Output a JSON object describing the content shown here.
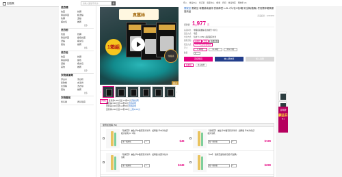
{
  "header": {
    "brand_label": "回首頁",
    "search_placeholder": "請輸入關鍵字查詢",
    "search_button": "搜",
    "nav": [
      "登入",
      "會員中心",
      "會員中心",
      "查訂單",
      "購物車",
      "客服中心",
      "優惠",
      "折扣",
      "會員專區",
      "購物車 (0)"
    ]
  },
  "sidebar": {
    "sections": [
      {
        "title": "洗衣精",
        "items": [
          "抗菌",
          "抗蹣",
          "除臭抑菌",
          "超濃縮",
          "防蹣",
          "濃縮",
          "補充包",
          "推薦"
        ],
        "more": "更多"
      },
      {
        "title": "洗衣粉",
        "items": [
          "抗菌",
          "抗蹣",
          "除臭抑菌",
          "護色抗菌",
          "濃縮",
          "補充包",
          "其他",
          "推薦"
        ],
        "more": "更多"
      },
      {
        "title": "洗衣皂",
        "items": [
          "抗菌",
          "抗蹣",
          "除臭抑菌",
          "護色",
          "濃縮",
          "補充包",
          "其他",
          "推薦"
        ],
        "more": "更多"
      },
      {
        "title": "衣物清潔劑",
        "items": [
          "漂白水",
          "漂白粉",
          "柔軟精",
          "去漬劑",
          "衣領精",
          "洗衣球",
          "其他",
          "推薦"
        ],
        "more": "更多"
      },
      {
        "title": "衣物香氛",
        "items": [
          "香氛袋",
          "香氛噴霧"
        ]
      }
    ]
  },
  "product": {
    "title_brand": "蕾妮亞",
    "title": "蕾妮亞 零觸感真蠶絲 夜用褲型 L-XL 7片/包 8包/箱 衛生棉(箱購)-會員獨享箱購優惠商品",
    "code": "商品編號：12659865",
    "gallery_title": "真蠶絲",
    "gallery_badge": "1箱組",
    "gallery_seal": "零觸感",
    "gallery_caption": "官方",
    "price_label": "促銷價",
    "price": "1,977",
    "price_unit": "元",
    "specs": [
      {
        "k": "商品特色",
        "v": "零觸感真蠶絲 夜用褲型 7片/包"
      },
      {
        "k": "運送方式",
        "v": "宅配"
      },
      {
        "k": "付款方式",
        "v": "信用卡 / ATM / 超商取貨付款"
      }
    ],
    "chips_label": "優惠活動",
    "chips": [
      "滿額折",
      "全館",
      "點數回饋"
    ],
    "shipping_label": "配送方式",
    "shipping_value": "momo宅配/超商取貨",
    "size_label": "尺寸",
    "sizes": [
      "L 102片",
      "XL 96片",
      "XXL 72片"
    ],
    "qty_label": "數量",
    "qty": "1",
    "buttons": {
      "buy": "直接購買",
      "cart": "放入購物車",
      "fav": "加入追蹤"
    },
    "share": [
      "點數換",
      "更多推薦"
    ]
  },
  "promo": {
    "tag": "滿額送",
    "lines": [
      {
        "text": "單筆滿1,000元送 mo幣10元",
        "link": "活動說明"
      },
      {
        "text": "單筆滿2,000元送 mo幣30元",
        "link": "活動說明"
      },
      {
        "text": "單筆滿3,000元送 mo幣50元",
        "link": "活動說明"
      },
      {
        "text": "單筆滿5,000元送 mo幣100元 ",
        "link": "上限3,000元"
      }
    ]
  },
  "bundle": {
    "header": "優惠加價購 (50)",
    "items": [
      {
        "name": "【蕾妮亞】 麗生草中醫豆漿清淨清 · 加購價 草本淨化舒緩沐浴乳(9 / 6件)",
        "option": "選一個規格",
        "qty": "1",
        "price": "$49"
      },
      {
        "name": "【蕾妮亞】 麗生草中醫豆漿清淨清 · 加購價 草本淨化舒緩沐浴乳",
        "option": "選一個規格",
        "qty": "1",
        "price": "$129"
      },
      {
        "name": "【蕾妮亞】 麗生草中醫豆漿清淨清 · 加購價 抗菌淨化沐浴乳",
        "option": "選一個規格",
        "qty": "1",
        "price": "$249"
      },
      {
        "name": "【HE】 蕾妮亞護墊旅行組(可加購)",
        "option": "選一個規格",
        "qty": "1",
        "price": "$299"
      }
    ]
  },
  "rightcol": {
    "ad_title": "週年慶",
    "ad_main": "顧品日",
    "ad_sub": "8.1"
  },
  "colors": {
    "accent": "#e4007f",
    "navy": "#233e8b",
    "link": "#1f66c7"
  }
}
